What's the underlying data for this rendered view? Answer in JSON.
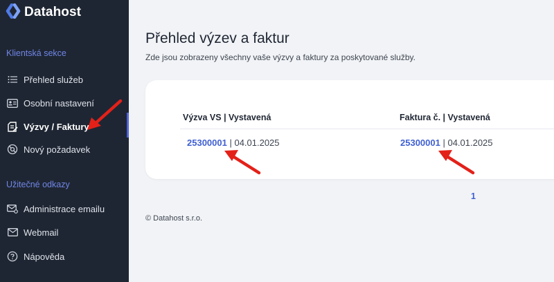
{
  "brand": {
    "name": "Datahost"
  },
  "sidebar": {
    "section1": "Klientská sekce",
    "items": [
      {
        "label": "Přehled služeb",
        "icon": "list-icon"
      },
      {
        "label": "Osobní nastavení",
        "icon": "id-card-icon"
      },
      {
        "label": "Výzvy / Faktury",
        "icon": "invoice-icon",
        "active": true
      },
      {
        "label": "Nový požadavek",
        "icon": "support-icon"
      }
    ],
    "section2": "Užitečné odkazy",
    "links": [
      {
        "label": "Administrace emailu",
        "icon": "mail-settings-icon"
      },
      {
        "label": "Webmail",
        "icon": "mail-icon"
      },
      {
        "label": "Nápověda",
        "icon": "help-icon"
      }
    ]
  },
  "main": {
    "title": "Přehled výzev a faktur",
    "subtitle": "Zde jsou zobrazeny všechny vaše výzvy a faktury za poskytované služby.",
    "table": {
      "columns": [
        "Výzva VS | Vystavená",
        "Faktura č. | Vystavená"
      ],
      "rows": [
        {
          "vs": "25300001",
          "vs_date": "| 04.01.2025",
          "invoice": "25300001",
          "invoice_date": "| 04.01.2025"
        }
      ]
    },
    "pagination": {
      "current": "1"
    },
    "footer": "© Datahost s.r.o."
  },
  "colors": {
    "sidebar_bg": "#1f2633",
    "accent": "#3f5fd2",
    "annotation_arrow": "#e32119"
  }
}
